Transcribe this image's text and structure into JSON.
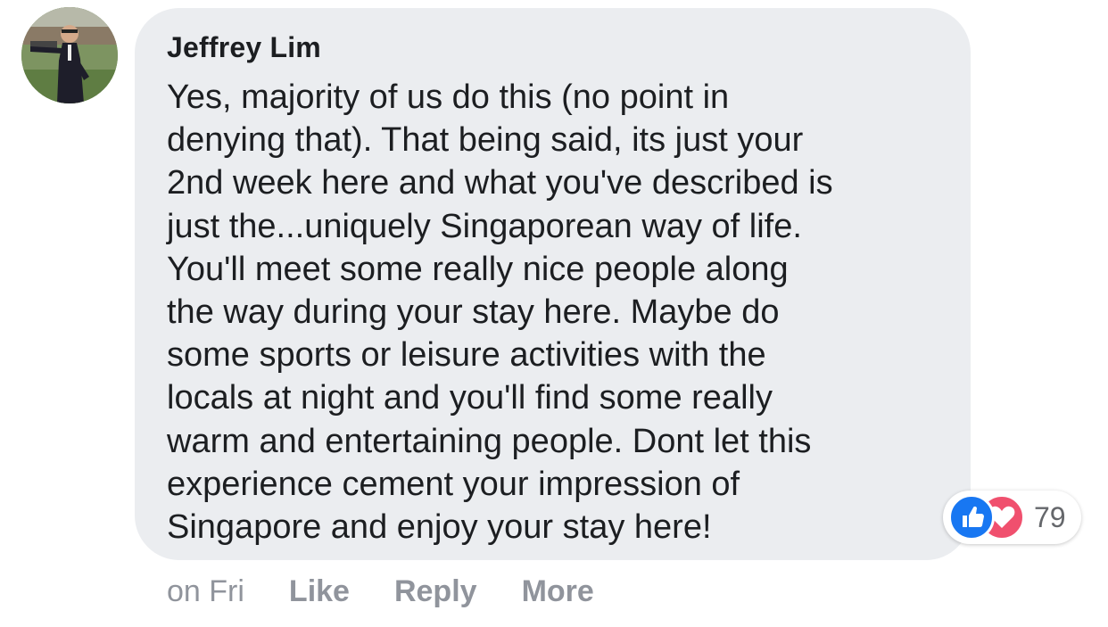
{
  "comment": {
    "author": "Jeffrey Lim",
    "text_lines": [
      "Yes, majority of us do this (no point in",
      "denying that). That being said, its just your",
      "2nd week here and what you've described is",
      "just the...uniquely Singaporean way of life.",
      "You'll meet some really nice people along",
      "the way during your stay here. Maybe do",
      "some sports or leisure activities with the",
      "locals at night and you'll find some really",
      "warm and entertaining people. Dont let this",
      "experience cement your impression of",
      "Singapore and enjoy your stay here!"
    ],
    "avatar_icon": "profile-photo"
  },
  "reactions": {
    "icons": [
      "like-icon",
      "love-icon"
    ],
    "count": "79",
    "like_color": "#1877f2",
    "love_color": "#f0506e"
  },
  "actions": {
    "time": "on Fri",
    "like_label": "Like",
    "reply_label": "Reply",
    "more_label": "More"
  },
  "colors": {
    "bubble_background": "#ebedf0",
    "action_text": "#90949c"
  }
}
